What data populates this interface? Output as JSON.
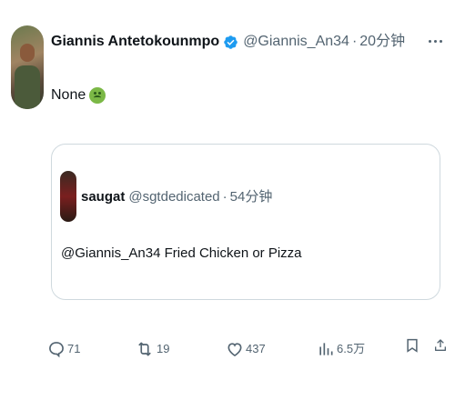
{
  "author": {
    "name": "Giannis Antetokounmpo",
    "handle": "@Giannis_An34",
    "separator": "·",
    "time": "20分钟"
  },
  "tweet": {
    "text": "None",
    "emoji": "nauseated-face-emoji"
  },
  "quoted": {
    "name": "saugat",
    "handle": "@sgtdedicated",
    "separator": "·",
    "time": "54分钟",
    "text": "@Giannis_An34 Fried Chicken or Pizza"
  },
  "actions": {
    "replies": "71",
    "retweets": "19",
    "likes": "437",
    "views": "6.5万"
  },
  "colors": {
    "text": "#0f1419",
    "muted": "#536471",
    "verified": "#1d9bf0",
    "border": "#cfd9de"
  }
}
